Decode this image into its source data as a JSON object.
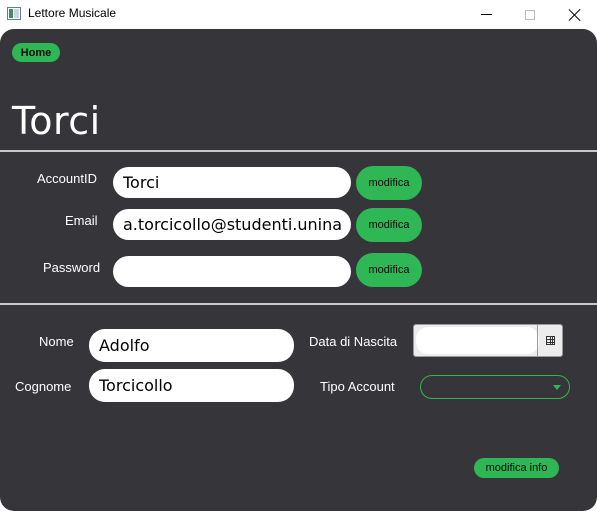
{
  "window": {
    "title": "Lettore Musicale"
  },
  "nav": {
    "home_label": "Home"
  },
  "page": {
    "title": "Torci"
  },
  "account": {
    "accountid_label": "AccountID",
    "accountid_value": "Torci",
    "email_label": "Email",
    "email_value": "a.torcicollo@studenti.unina.it",
    "password_label": "Password",
    "password_value": "",
    "modify_label": "modifica"
  },
  "info": {
    "nome_label": "Nome",
    "nome_value": "Adolfo",
    "cognome_label": "Cognome",
    "cognome_value": "Torcicollo",
    "data_nascita_label": "Data di Nascita",
    "data_nascita_value": "",
    "tipo_account_label": "Tipo Account",
    "tipo_account_value": "",
    "modify_info_label": "modifica info"
  },
  "colors": {
    "accent": "#2fb755",
    "background": "#36363a",
    "divider": "#c9c9c9"
  },
  "icons": {
    "date_picker": "calendar-icon",
    "select": "chevron-down-icon"
  }
}
